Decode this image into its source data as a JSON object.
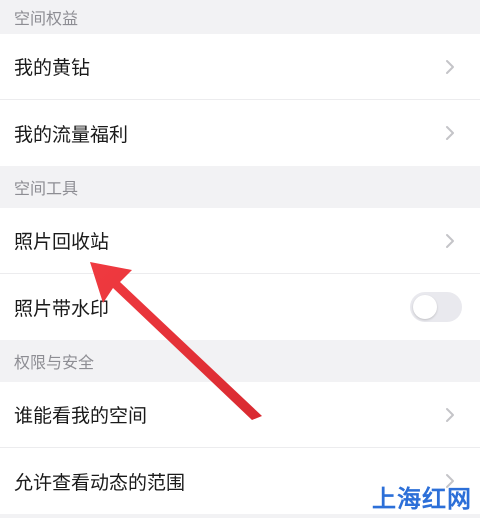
{
  "sections": [
    {
      "header": "空间权益",
      "items": [
        {
          "label": "我的黄钻",
          "control": "chevron"
        },
        {
          "label": "我的流量福利",
          "control": "chevron"
        }
      ]
    },
    {
      "header": "空间工具",
      "items": [
        {
          "label": "照片回收站",
          "control": "chevron"
        },
        {
          "label": "照片带水印",
          "control": "toggle",
          "toggle_on": false
        }
      ]
    },
    {
      "header": "权限与安全",
      "items": [
        {
          "label": "谁能看我的空间",
          "control": "chevron"
        },
        {
          "label": "允许查看动态的范围",
          "control": "chevron"
        }
      ]
    }
  ],
  "colors": {
    "annotation_arrow": "#e8343c",
    "watermark": "#2c6fd8",
    "section_bg": "#f2f2f4"
  },
  "watermark": "上海红网"
}
